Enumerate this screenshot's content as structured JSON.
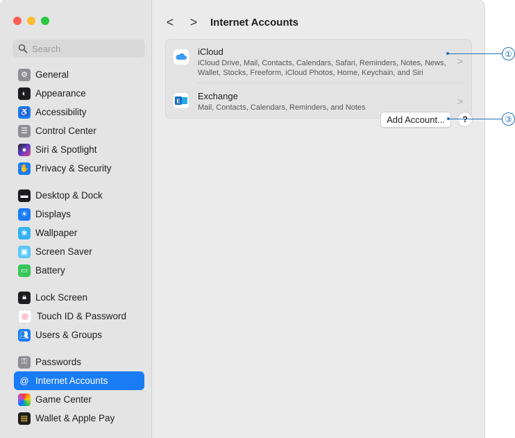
{
  "search": {
    "placeholder": "Search"
  },
  "sidebar": {
    "items": [
      {
        "label": "General",
        "icon": "gear-icon",
        "color": "#8e8e93"
      },
      {
        "label": "Appearance",
        "icon": "appearance-icon",
        "color": "#1d1d1f"
      },
      {
        "label": "Accessibility",
        "icon": "accessibility-icon",
        "color": "#1a7cf5"
      },
      {
        "label": "Control Center",
        "icon": "control-center-icon",
        "color": "#8e8e93"
      },
      {
        "label": "Siri & Spotlight",
        "icon": "siri-icon",
        "color": "#5e3ec8"
      },
      {
        "label": "Privacy & Security",
        "icon": "hand-icon",
        "color": "#1a7cf5"
      },
      {
        "label": "Desktop & Dock",
        "icon": "dock-icon",
        "color": "#1d1d1f"
      },
      {
        "label": "Displays",
        "icon": "displays-icon",
        "color": "#1a7cf5"
      },
      {
        "label": "Wallpaper",
        "icon": "wallpaper-icon",
        "color": "#33b3f0"
      },
      {
        "label": "Screen Saver",
        "icon": "screen-saver-icon",
        "color": "#5ac8fa"
      },
      {
        "label": "Battery",
        "icon": "battery-icon",
        "color": "#34c759"
      },
      {
        "label": "Lock Screen",
        "icon": "lock-icon",
        "color": "#1d1d1f"
      },
      {
        "label": "Touch ID & Password",
        "icon": "fingerprint-icon",
        "color": "#ffffff"
      },
      {
        "label": "Users & Groups",
        "icon": "users-icon",
        "color": "#1a7cf5"
      },
      {
        "label": "Passwords",
        "icon": "key-icon",
        "color": "#8e8e93"
      },
      {
        "label": "Internet Accounts",
        "icon": "at-icon",
        "color": "#1a7cf5",
        "active": true
      },
      {
        "label": "Game Center",
        "icon": "game-center-icon",
        "color": "#ffffff"
      },
      {
        "label": "Wallet & Apple Pay",
        "icon": "wallet-icon",
        "color": "#1d1d1f"
      }
    ]
  },
  "header": {
    "back": "<",
    "forward": ">",
    "title": "Internet Accounts"
  },
  "accounts": [
    {
      "name": "iCloud",
      "desc_line1": "iCloud Drive, Mail, Contacts, Calendars, Safari, Reminders, Notes, News,",
      "desc_line2": "Wallet, Stocks, Freeform, iCloud Photos, Home, Keychain, and Siri",
      "icon": "icloud-icon"
    },
    {
      "name": "Exchange",
      "desc_line1": "Mail, Contacts, Calendars, Reminders, and Notes",
      "icon": "exchange-icon"
    }
  ],
  "buttons": {
    "add_account": "Add Account...",
    "help": "?"
  },
  "callouts": [
    "①",
    "③"
  ]
}
